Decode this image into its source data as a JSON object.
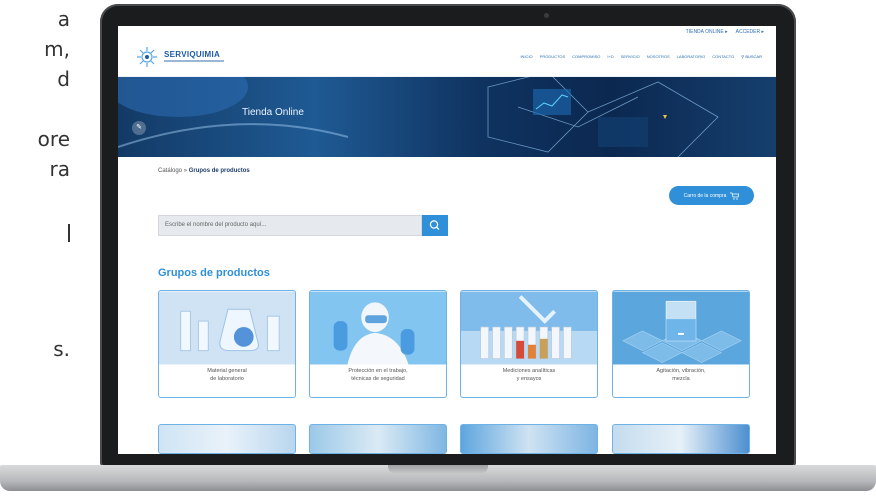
{
  "background_text": [
    "a",
    "m,",
    "d",
    "",
    "ore",
    "ra",
    "",
    "",
    "",
    "s."
  ],
  "site": {
    "brand": "SERVIQUIMIA",
    "topbar": [
      "TIENDA ONLINE ▸",
      "ACCEDER ▸"
    ],
    "nav": [
      "INICIO",
      "PRODUCTOS",
      "COMPROMISO",
      "I+D",
      "SERVICIO",
      "NOSOTROS",
      "LABORATORIO",
      "CONTACTO",
      "⚲ BUSCAR"
    ],
    "hero_title": "Tienda Online",
    "hero_button": "✎",
    "breadcrumb": {
      "root": "Catálogo",
      "separator": " » ",
      "current": "Grupos de productos"
    },
    "cart_button": "Carro de la compra",
    "search_placeholder": "Escribe el nombre del producto aquí...",
    "section_title": "Grupos de productos",
    "cards": [
      {
        "line1": "Material general",
        "line2": "de laboratorio"
      },
      {
        "line1": "Protección en el trabajo,",
        "line2": "técnicas de seguridad"
      },
      {
        "line1": "Mediciones analíticas",
        "line2": "y ensayos"
      },
      {
        "line1": "Agitación, vibración,",
        "line2": "mezcla"
      }
    ]
  },
  "colors": {
    "accent": "#2f8fd8",
    "brand": "#1d5aa6"
  }
}
